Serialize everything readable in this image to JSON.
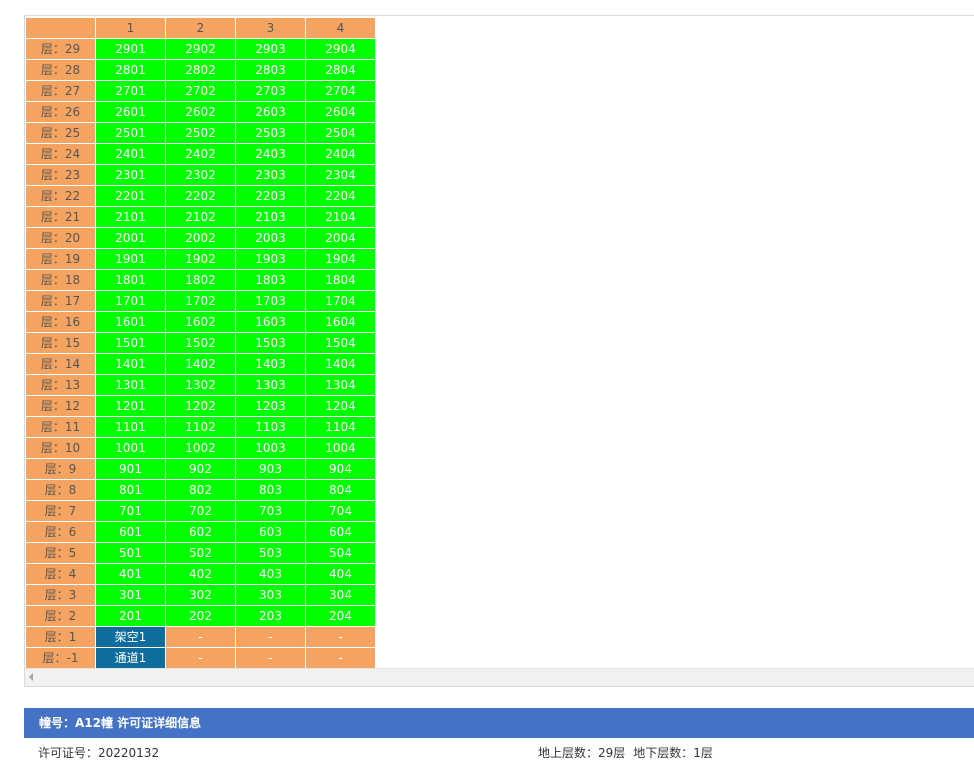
{
  "grid": {
    "column_headers": [
      "",
      "1",
      "2",
      "3",
      "4"
    ],
    "rows": [
      {
        "floor": "层：29",
        "units": [
          "2901",
          "2902",
          "2903",
          "2904"
        ],
        "status": [
          "sale",
          "sale",
          "sale",
          "sale"
        ]
      },
      {
        "floor": "层：28",
        "units": [
          "2801",
          "2802",
          "2803",
          "2804"
        ],
        "status": [
          "sale",
          "sale",
          "sale",
          "sale"
        ]
      },
      {
        "floor": "层：27",
        "units": [
          "2701",
          "2702",
          "2703",
          "2704"
        ],
        "status": [
          "sale",
          "sale",
          "sale",
          "sale"
        ]
      },
      {
        "floor": "层：26",
        "units": [
          "2601",
          "2602",
          "2603",
          "2604"
        ],
        "status": [
          "sale",
          "sale",
          "sale",
          "sale"
        ]
      },
      {
        "floor": "层：25",
        "units": [
          "2501",
          "2502",
          "2503",
          "2504"
        ],
        "status": [
          "sale",
          "sale",
          "sale",
          "sale"
        ]
      },
      {
        "floor": "层：24",
        "units": [
          "2401",
          "2402",
          "2403",
          "2404"
        ],
        "status": [
          "sale",
          "sale",
          "sale",
          "sale"
        ]
      },
      {
        "floor": "层：23",
        "units": [
          "2301",
          "2302",
          "2303",
          "2304"
        ],
        "status": [
          "sale",
          "sale",
          "sale",
          "sale"
        ]
      },
      {
        "floor": "层：22",
        "units": [
          "2201",
          "2202",
          "2203",
          "2204"
        ],
        "status": [
          "sale",
          "sale",
          "sale",
          "sale"
        ]
      },
      {
        "floor": "层：21",
        "units": [
          "2101",
          "2102",
          "2103",
          "2104"
        ],
        "status": [
          "sale",
          "sale",
          "sale",
          "sale"
        ]
      },
      {
        "floor": "层：20",
        "units": [
          "2001",
          "2002",
          "2003",
          "2004"
        ],
        "status": [
          "sale",
          "sale",
          "sale",
          "sale"
        ]
      },
      {
        "floor": "层：19",
        "units": [
          "1901",
          "1902",
          "1903",
          "1904"
        ],
        "status": [
          "sale",
          "sale",
          "sale",
          "sale"
        ]
      },
      {
        "floor": "层：18",
        "units": [
          "1801",
          "1802",
          "1803",
          "1804"
        ],
        "status": [
          "sale",
          "sale",
          "sale",
          "sale"
        ]
      },
      {
        "floor": "层：17",
        "units": [
          "1701",
          "1702",
          "1703",
          "1704"
        ],
        "status": [
          "sale",
          "sale",
          "sale",
          "sale"
        ]
      },
      {
        "floor": "层：16",
        "units": [
          "1601",
          "1602",
          "1603",
          "1604"
        ],
        "status": [
          "sale",
          "sale",
          "sale",
          "sale"
        ]
      },
      {
        "floor": "层：15",
        "units": [
          "1501",
          "1502",
          "1503",
          "1504"
        ],
        "status": [
          "sale",
          "sale",
          "sale",
          "sale"
        ]
      },
      {
        "floor": "层：14",
        "units": [
          "1401",
          "1402",
          "1403",
          "1404"
        ],
        "status": [
          "sale",
          "sale",
          "sale",
          "sale"
        ]
      },
      {
        "floor": "层：13",
        "units": [
          "1301",
          "1302",
          "1303",
          "1304"
        ],
        "status": [
          "sale",
          "sale",
          "sale",
          "sale"
        ]
      },
      {
        "floor": "层：12",
        "units": [
          "1201",
          "1202",
          "1203",
          "1204"
        ],
        "status": [
          "sale",
          "sale",
          "sale",
          "sale"
        ]
      },
      {
        "floor": "层：11",
        "units": [
          "1101",
          "1102",
          "1103",
          "1104"
        ],
        "status": [
          "sale",
          "sale",
          "sale",
          "sale"
        ]
      },
      {
        "floor": "层：10",
        "units": [
          "1001",
          "1002",
          "1003",
          "1004"
        ],
        "status": [
          "sale",
          "sale",
          "sale",
          "sale"
        ]
      },
      {
        "floor": "层：9",
        "units": [
          "901",
          "902",
          "903",
          "904"
        ],
        "status": [
          "sale",
          "sale",
          "sale",
          "sale"
        ]
      },
      {
        "floor": "层：8",
        "units": [
          "801",
          "802",
          "803",
          "804"
        ],
        "status": [
          "sale",
          "sale",
          "sale",
          "sale"
        ]
      },
      {
        "floor": "层：7",
        "units": [
          "701",
          "702",
          "703",
          "704"
        ],
        "status": [
          "sale",
          "sale",
          "sale",
          "sale"
        ]
      },
      {
        "floor": "层：6",
        "units": [
          "601",
          "602",
          "603",
          "604"
        ],
        "status": [
          "sale",
          "sale",
          "sale",
          "sale"
        ]
      },
      {
        "floor": "层：5",
        "units": [
          "501",
          "502",
          "503",
          "504"
        ],
        "status": [
          "sale",
          "sale",
          "sale",
          "sale"
        ]
      },
      {
        "floor": "层：4",
        "units": [
          "401",
          "402",
          "403",
          "404"
        ],
        "status": [
          "sale",
          "sale",
          "sale",
          "sale"
        ]
      },
      {
        "floor": "层：3",
        "units": [
          "301",
          "302",
          "303",
          "304"
        ],
        "status": [
          "sale",
          "sale",
          "sale",
          "sale"
        ]
      },
      {
        "floor": "层：2",
        "units": [
          "201",
          "202",
          "203",
          "204"
        ],
        "status": [
          "sale",
          "sale",
          "sale",
          "sale"
        ]
      },
      {
        "floor": "层：1",
        "units": [
          "架空1",
          "-",
          "-",
          "-"
        ],
        "status": [
          "special",
          "none",
          "none",
          "none"
        ]
      },
      {
        "floor": "层：-1",
        "units": [
          "通道1",
          "-",
          "-",
          "-"
        ],
        "status": [
          "special",
          "none",
          "none",
          "none"
        ]
      }
    ],
    "colors": {
      "header_bg": "#f4a460",
      "sale_bg": "#00ff00",
      "special_bg": "#0d6e9e",
      "none_bg": "#f4a460"
    }
  },
  "info": {
    "title": "幢号：A12幢 许可证详细信息",
    "permit": "许可证号：20220132",
    "floors_above": "地上层数：29层",
    "floors_below": "地下层数：1层",
    "title_bg": "#4472c4"
  }
}
